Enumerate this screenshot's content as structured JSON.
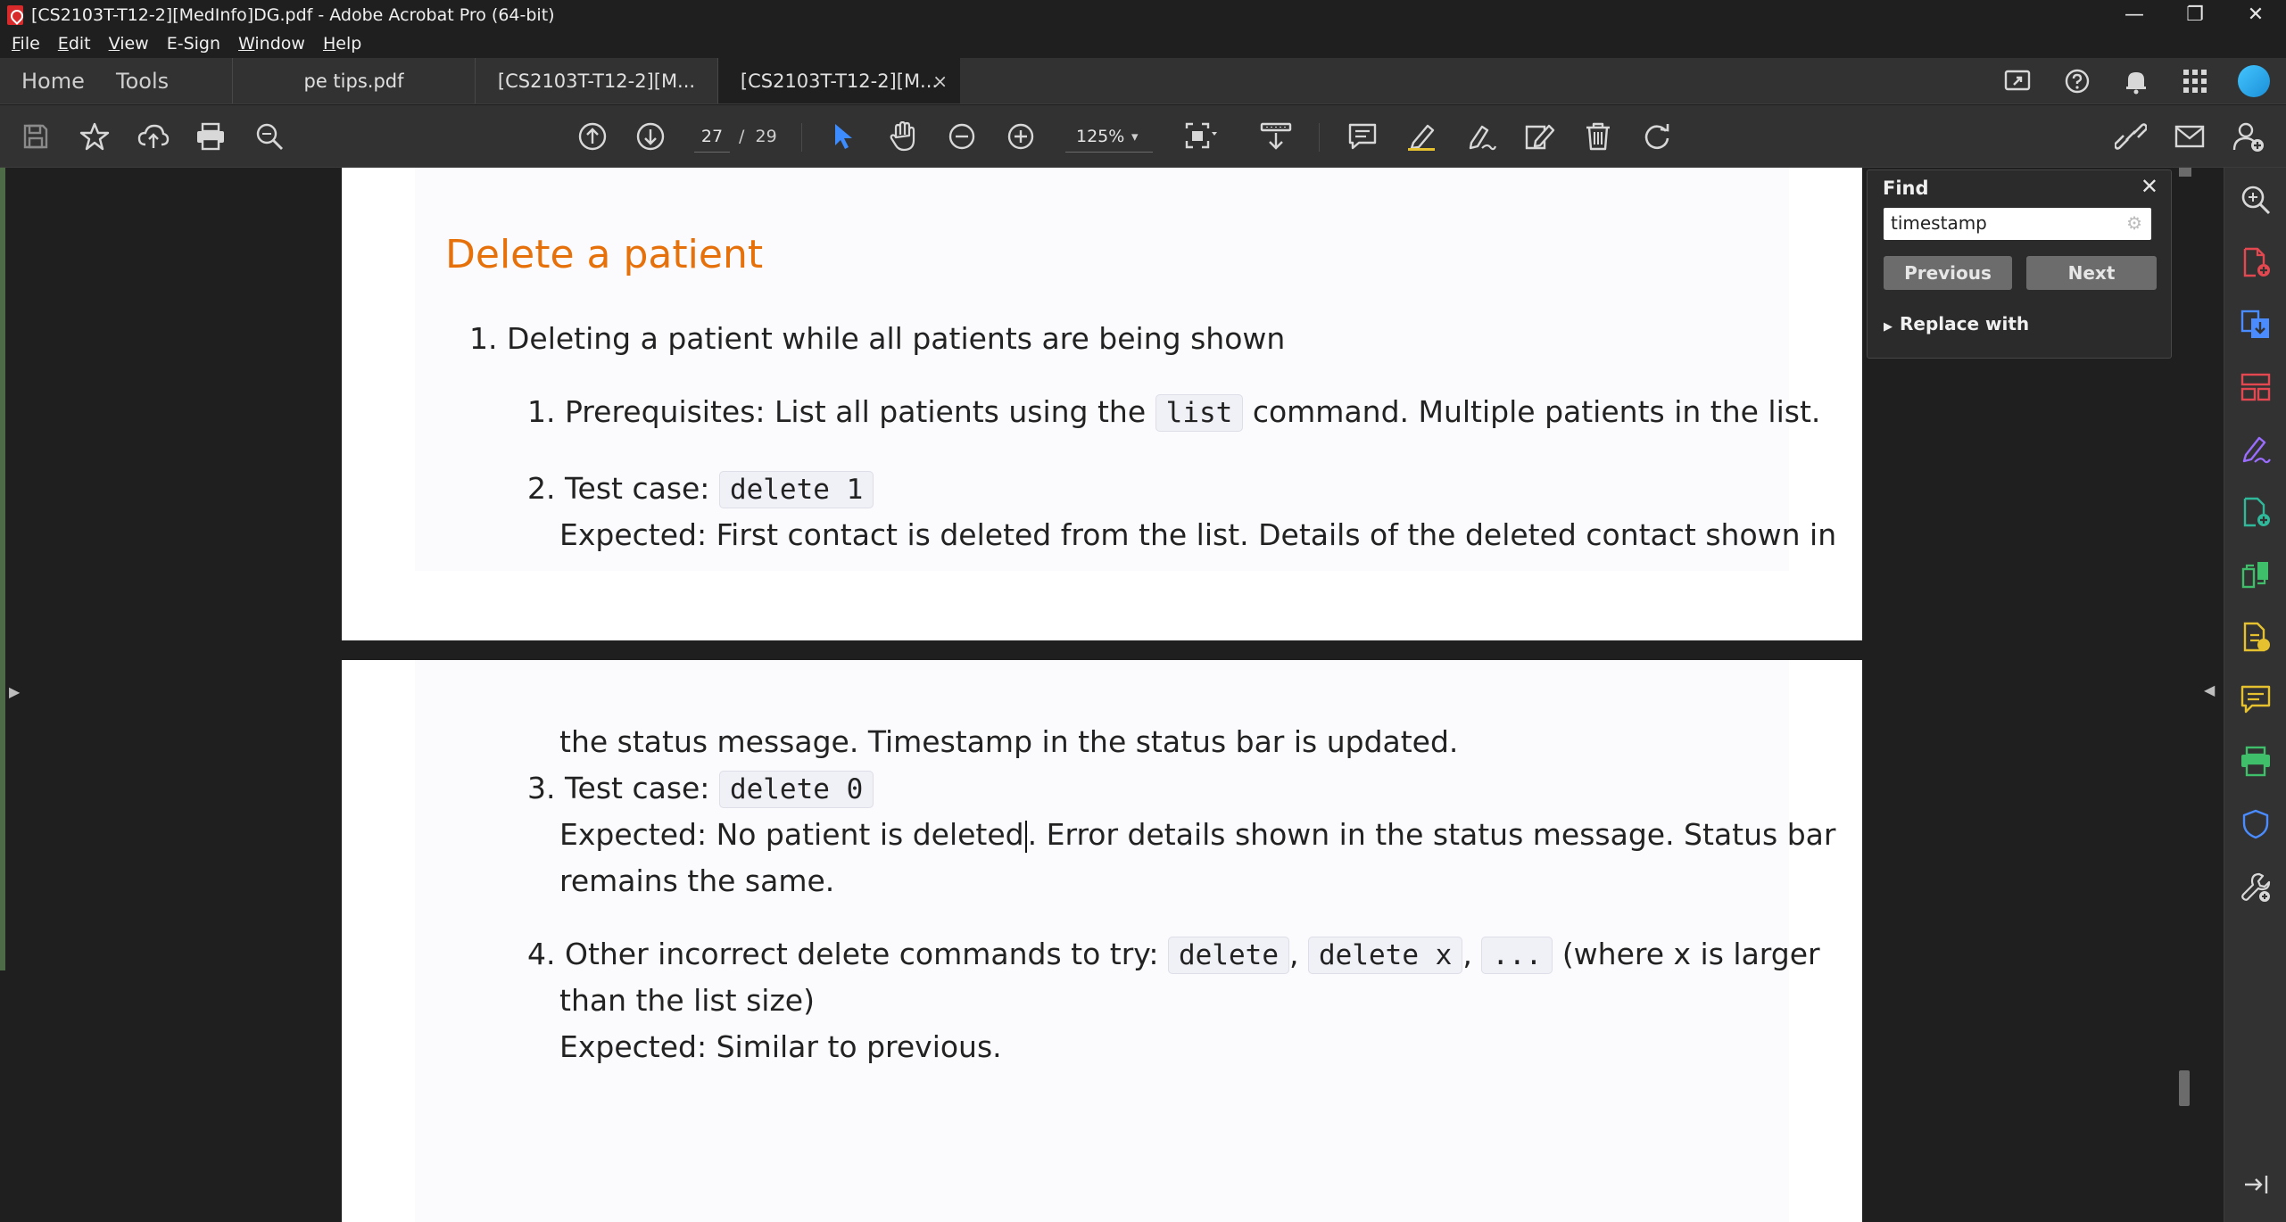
{
  "window": {
    "title": "[CS2103T-T12-2][MedInfo]DG.pdf - Adobe Acrobat Pro (64-bit)",
    "minimize": "—",
    "restore": "❐",
    "close": "✕"
  },
  "menu": {
    "items": [
      {
        "key": "F",
        "rest": "ile"
      },
      {
        "key": "E",
        "rest": "dit"
      },
      {
        "key": "V",
        "rest": "iew"
      },
      {
        "key": "",
        "rest": "E-Sign"
      },
      {
        "key": "W",
        "rest": "indow"
      },
      {
        "key": "H",
        "rest": "elp"
      }
    ]
  },
  "tabs": {
    "home": "Home",
    "tools": "Tools",
    "docs": [
      "pe tips.pdf",
      "[CS2103T-T12-2][M...",
      "[CS2103T-T12-2][M..."
    ],
    "close_glyph": "×"
  },
  "toolbar": {
    "current_page": "27",
    "page_separator": "/",
    "total_pages": "29",
    "zoom": "125%",
    "zoom_caret": "▾"
  },
  "document": {
    "heading": "Delete a patient",
    "item1": "1. Deleting a patient while all patients are being shown",
    "sub1_prefix": "1. Prerequisites: List all patients using the",
    "sub1_code": "list",
    "sub1_suffix": "command. Multiple patients in the list.",
    "sub2_prefix": "2. Test case:",
    "sub2_code": "delete 1",
    "sub2_expected": "Expected: First contact is deleted from the list. Details of the deleted contact shown in",
    "sub2_cont": "the status message. Timestamp in the status bar is updated.",
    "sub3_prefix": "3. Test case:",
    "sub3_code": "delete 0",
    "sub3_expected_a": "Expected: No patient is deleted",
    "sub3_expected_b": ". Error details shown in the status message. Status bar",
    "sub3_cont": "remains the same.",
    "sub4_prefix": "4. Other incorrect delete commands to try:",
    "sub4_code1": "delete",
    "sub4_comma": ",",
    "sub4_code2": "delete x",
    "sub4_code3": "...",
    "sub4_suffix": "(where x is larger",
    "sub4_cont": "than the list size)",
    "sub4_expected": "Expected: Similar to previous."
  },
  "find": {
    "title": "Find",
    "close": "✕",
    "query": "timestamp",
    "gear": "⚙",
    "previous": "Previous",
    "next": "Next",
    "replace_caret": "▶",
    "replace_with": "Replace with"
  },
  "colors": {
    "heading": "#e6710b",
    "accent_blue": "#3c8cff",
    "rail_red": "#e34850",
    "rail_blue": "#4a8cff",
    "rail_purple": "#9a6cff",
    "rail_green": "#3fbf6a",
    "rail_yellow": "#e6c12f",
    "rail_teal": "#2fb89a"
  }
}
